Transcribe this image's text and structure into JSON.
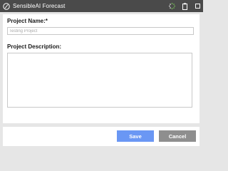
{
  "window": {
    "title": "SensibleAI Forecast",
    "icons": [
      "app-logo-icon",
      "loading-spinner-icon",
      "clipboard-icon",
      "maximize-icon"
    ]
  },
  "form": {
    "project_name_label": "Project Name:*",
    "project_name_placeholder": "Testing Project",
    "project_description_label": "Project Description:"
  },
  "footer": {
    "save_label": "Save",
    "cancel_label": "Cancel"
  },
  "colors": {
    "titlebar": "#4a4a4a",
    "save_button": "#6a97f4",
    "cancel_button": "#8e8e8e",
    "background": "#e6e6e6"
  }
}
